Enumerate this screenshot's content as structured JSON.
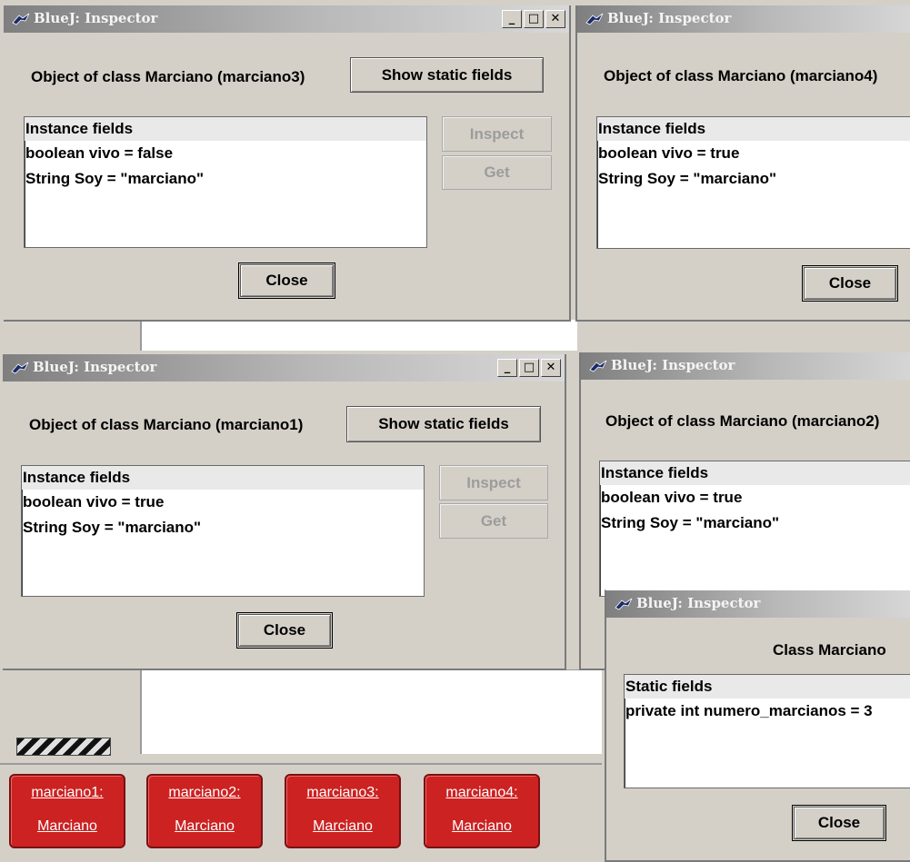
{
  "inspectors": [
    {
      "title": "BlueJ: Inspector",
      "heading": "Object of class Marciano (marciano3)",
      "static_button": "Show static fields",
      "fields_header": "Instance fields",
      "fields": [
        "boolean vivo = false",
        "String Soy = \"marciano\""
      ],
      "inspect_label": "Inspect",
      "get_label": "Get",
      "close_label": "Close"
    },
    {
      "title": "BlueJ: Inspector",
      "heading": "Object of class Marciano (marciano4)",
      "fields_header": "Instance fields",
      "fields": [
        "boolean vivo = true",
        "String Soy = \"marciano\""
      ],
      "close_label": "Close"
    },
    {
      "title": "BlueJ: Inspector",
      "heading": "Object of class Marciano (marciano1)",
      "static_button": "Show static fields",
      "fields_header": "Instance fields",
      "fields": [
        "boolean vivo = true",
        "String Soy = \"marciano\""
      ],
      "inspect_label": "Inspect",
      "get_label": "Get",
      "close_label": "Close"
    },
    {
      "title": "BlueJ: Inspector",
      "heading": "Object of class Marciano (marciano2)",
      "fields_header": "Instance fields",
      "fields": [
        "boolean vivo = true",
        "String Soy = \"marciano\""
      ]
    },
    {
      "title": "BlueJ: Inspector",
      "heading": "Class Marciano",
      "fields_header": "Static fields",
      "fields": [
        "private int numero_marcianos = 3"
      ],
      "close_label": "Close"
    }
  ],
  "window_controls": {
    "minimize": "_",
    "maximize": "□",
    "close": "✕"
  },
  "object_bench": [
    {
      "name": "marciano1:",
      "class": "Marciano"
    },
    {
      "name": "marciano2:",
      "class": "Marciano"
    },
    {
      "name": "marciano3:",
      "class": "Marciano"
    },
    {
      "name": "marciano4:",
      "class": "Marciano"
    }
  ],
  "colors": {
    "object_fill": "#cc2222",
    "window_bg": "#d4d0c8",
    "title_gradient_start": "#7f7f7f"
  },
  "icons": {
    "app": "bluej-bird-icon"
  }
}
